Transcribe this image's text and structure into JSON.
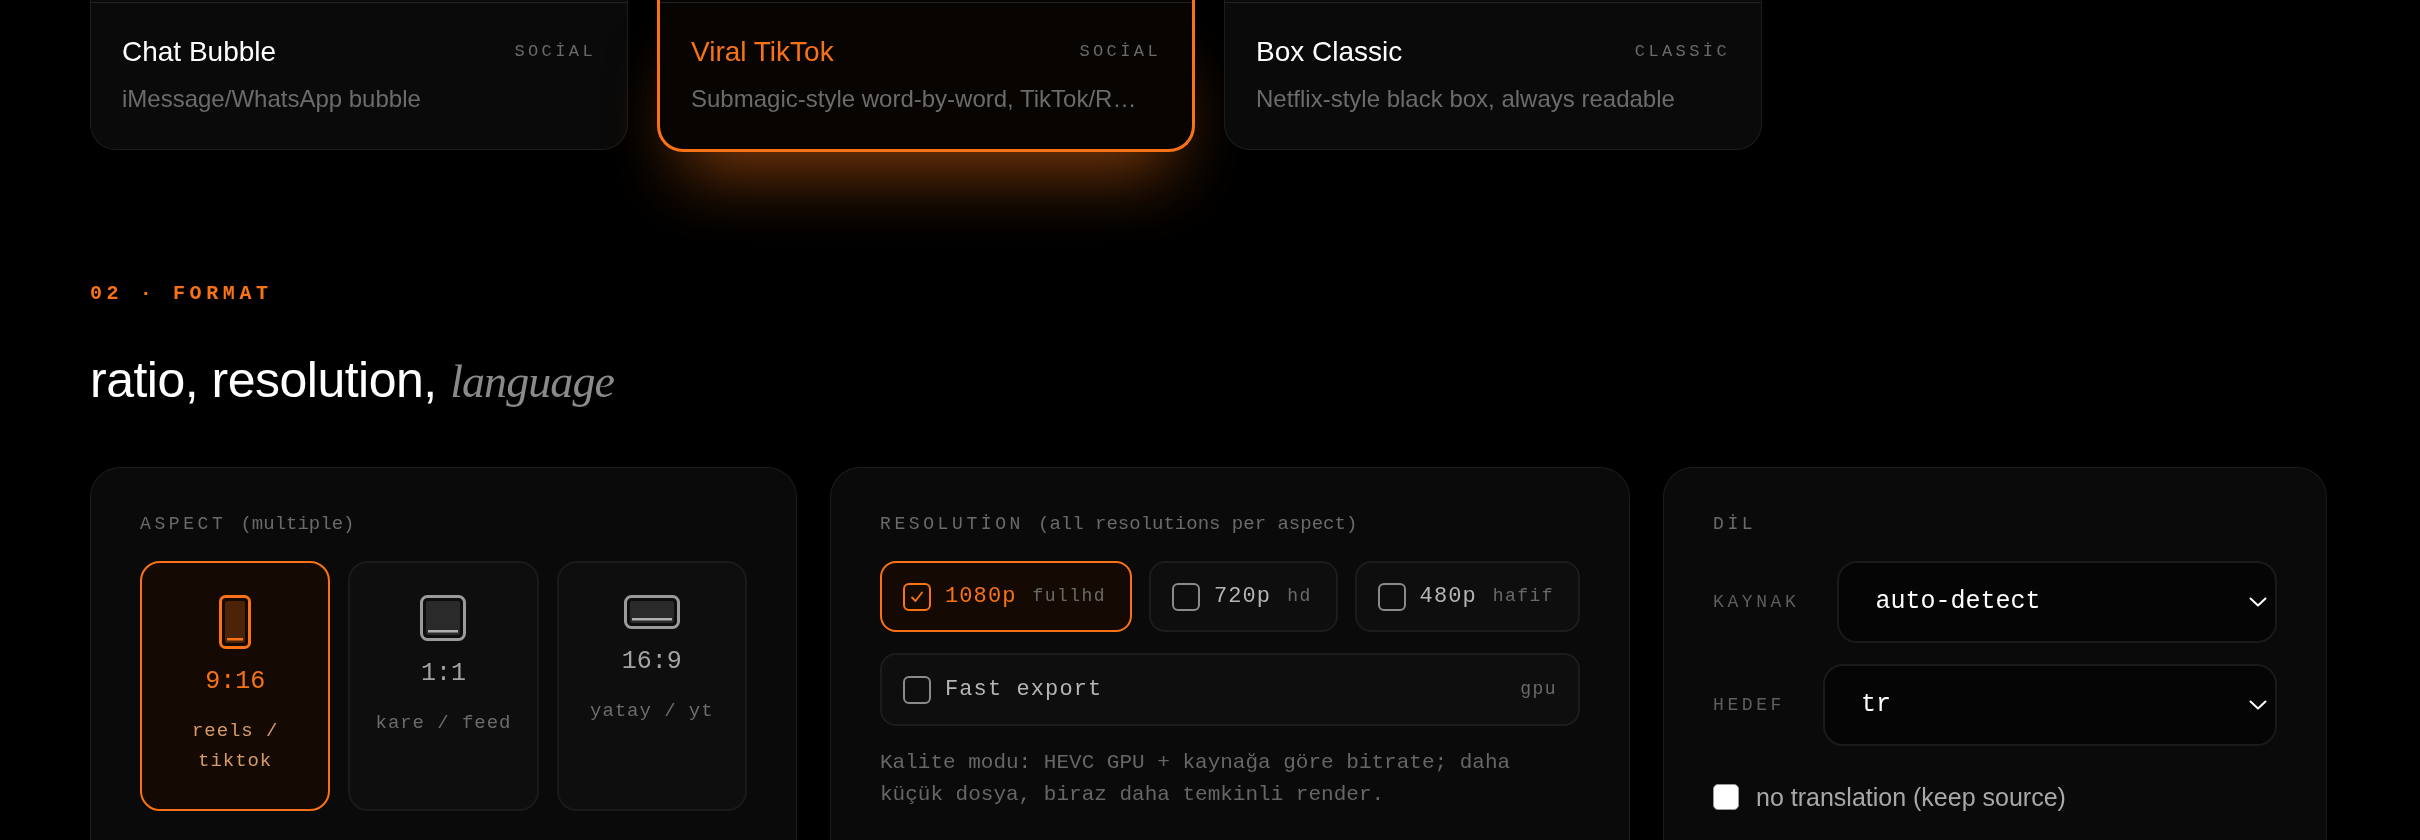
{
  "style_cards": [
    {
      "title": "Chat Bubble",
      "tag": "SOCİAL",
      "description": "iMessage/WhatsApp bubble",
      "selected": false
    },
    {
      "title": "Viral TikTok",
      "tag": "SOCİAL",
      "description": "Submagic-style word-by-word, TikTok/R…",
      "selected": true
    },
    {
      "title": "Box Classic",
      "tag": "CLASSİC",
      "description": "Netflix-style black box, always readable",
      "selected": false
    }
  ],
  "section": {
    "label": "02 · FORMAT",
    "heading": "ratio, resolution, *language*"
  },
  "aspect": {
    "label": "ASPECT",
    "hint": "(multiple)",
    "options": [
      {
        "kind": "portrait",
        "ratio": "9:16",
        "caption": "reels / tiktok",
        "selected": true
      },
      {
        "kind": "square",
        "ratio": "1:1",
        "caption": "kare / feed",
        "selected": false
      },
      {
        "kind": "landscape",
        "ratio": "16:9",
        "caption": "yatay / yt",
        "selected": false
      }
    ]
  },
  "resolution": {
    "label": "RESOLUTİON",
    "hint": "(all resolutions per aspect)",
    "options": [
      {
        "label": "1080p",
        "sub": "fullhd",
        "checked": true
      },
      {
        "label": "720p",
        "sub": "hd",
        "checked": false
      },
      {
        "label": "480p",
        "sub": "hafif",
        "checked": false
      }
    ],
    "fast_export": {
      "label": "Fast export",
      "tag": "gpu",
      "checked": false
    },
    "note": "Kalite modu: HEVC GPU + kaynağa göre bitrate; daha küçük dosya, biraz daha temkinli render."
  },
  "language": {
    "label": "DİL",
    "fields": [
      {
        "label": "KAYNAK",
        "value": "auto-detect"
      },
      {
        "label": "HEDEF",
        "value": "tr"
      }
    ],
    "no_translation": {
      "label": "no translation (keep source)",
      "checked": false
    }
  }
}
